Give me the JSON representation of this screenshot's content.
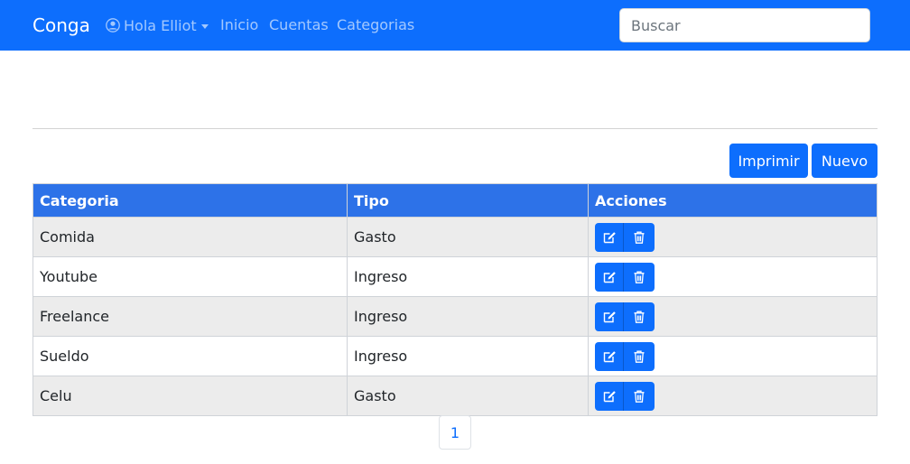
{
  "navbar": {
    "brand": "Conga",
    "user_label": "Hola Elliot",
    "links": [
      "Inicio",
      "Cuentas",
      "Categorias"
    ],
    "search_placeholder": "Buscar"
  },
  "toolbar": {
    "print_label": "Imprimir",
    "new_label": "Nuevo"
  },
  "table": {
    "headers": [
      "Categoria",
      "Tipo",
      "Acciones"
    ],
    "rows": [
      {
        "categoria": "Comida",
        "tipo": "Gasto"
      },
      {
        "categoria": "Youtube",
        "tipo": "Ingreso"
      },
      {
        "categoria": "Freelance",
        "tipo": "Ingreso"
      },
      {
        "categoria": "Sueldo",
        "tipo": "Ingreso"
      },
      {
        "categoria": "Celu",
        "tipo": "Gasto"
      }
    ],
    "row_actions": [
      "edit-icon",
      "trash-icon"
    ]
  },
  "pagination": {
    "current_page": "1"
  },
  "colors": {
    "primary": "#0d6efd",
    "header_bg": "#2d72e8",
    "striped_row": "#ececec"
  }
}
